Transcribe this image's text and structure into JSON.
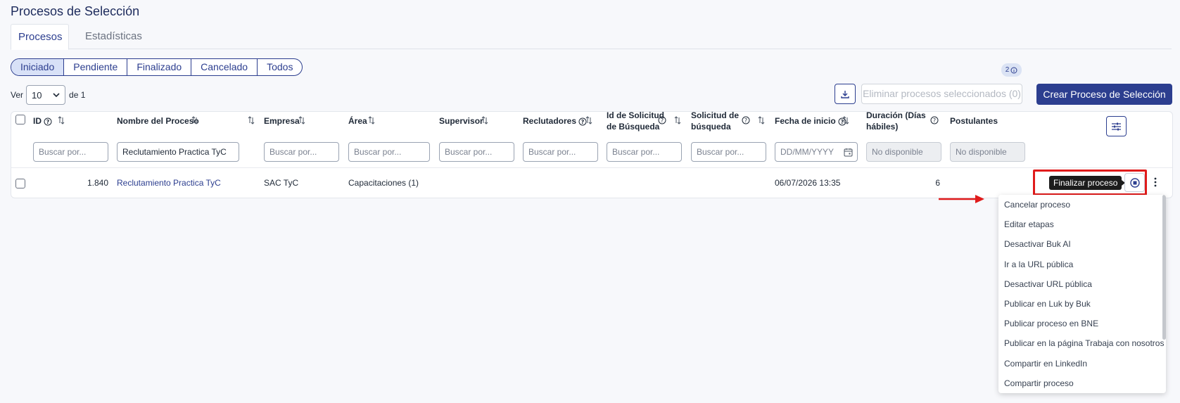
{
  "page": {
    "title": "Procesos de Selección"
  },
  "top_tabs": [
    {
      "label": "Procesos",
      "active": true
    },
    {
      "label": "Estadísticas",
      "active": false
    }
  ],
  "status_filters": [
    {
      "label": "Iniciado",
      "active": true
    },
    {
      "label": "Pendiente",
      "active": false
    },
    {
      "label": "Finalizado",
      "active": false
    },
    {
      "label": "Cancelado",
      "active": false
    },
    {
      "label": "Todos",
      "active": false
    }
  ],
  "pagination": {
    "ver_label": "Ver",
    "page_size": "10",
    "of_label": "de 1"
  },
  "toolbar": {
    "download_icon": "download-icon",
    "delete_label": "Eliminar procesos seleccionados (0)",
    "create_label": "Crear Proceso de Selección"
  },
  "columns": {
    "id": "ID",
    "nombre": "Nombre del Proceso",
    "empresa": "Empresa",
    "area": "Área",
    "supervisor": "Supervisor",
    "reclutadores": "Reclutadores",
    "id_solicitud_1": "Id de Solicitud",
    "id_solicitud_2": "de Búsqueda",
    "solicitud_1": "Solicitud de",
    "solicitud_2": "búsqueda",
    "fecha_inicio": "Fecha de inicio",
    "duracion_1": "Duración (Días",
    "duracion_2": "hábiles)",
    "postulantes": "Postulantes"
  },
  "filters": {
    "id": "Buscar por...",
    "nombre": "Reclutamiento Practica TyC",
    "empresa": "Buscar por...",
    "area": "Buscar por...",
    "supervisor": "Buscar por...",
    "reclutadores": "Buscar por...",
    "id_solicitud": "Buscar por...",
    "solicitud": "Buscar por...",
    "fecha": "DD/MM/YYYY",
    "duracion": "No disponible",
    "postulantes": "No disponible"
  },
  "row": {
    "id": "1.840",
    "nombre": "Reclutamiento Practica TyC",
    "empresa": "SAC TyC",
    "area": "Capacitaciones (1)",
    "fecha_inicio": "06/07/2026 13:35",
    "duracion": "6",
    "postulantes_badge": "2"
  },
  "tooltip": {
    "label": "Finalizar proceso"
  },
  "action_menu": [
    "Cancelar proceso",
    "Editar etapas",
    "Desactivar Buk AI",
    "Ir a la URL pública",
    "Desactivar URL pública",
    "Publicar en Luk by Buk",
    "Publicar proceso en BNE",
    "Publicar en la página Trabaja con nosotros",
    "Compartir en LinkedIn",
    "Compartir proceso"
  ],
  "colors": {
    "primary": "#2c3e8f",
    "highlight": "#e01b1b"
  }
}
